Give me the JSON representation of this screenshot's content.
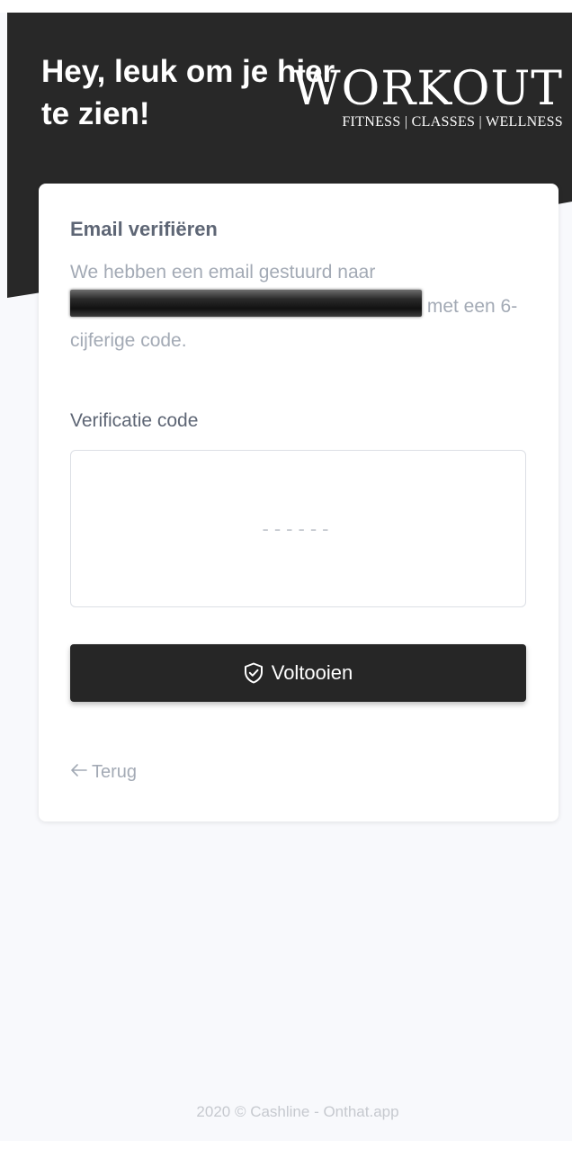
{
  "header": {
    "greeting": "Hey, leuk om je hier te zien!",
    "brand_name": "WORKOUT",
    "brand_tagline": "FITNESS | CLASSES | WELLNESS"
  },
  "verify": {
    "title": "Email verifiëren",
    "description_start": "We hebben een email gestuurd naar",
    "description_end": "met een 6-cijferige code.",
    "code_label": "Verificatie code",
    "code_placeholder": "------",
    "code_value": "",
    "submit_label": "Voltooien",
    "submit_icon": "shield-check-icon",
    "back_label": "Terug",
    "back_icon": "arrow-left-icon"
  },
  "footer": {
    "text": "2020 © Cashline - Onthat.app"
  },
  "colors": {
    "header_bg": "#282828",
    "page_bg": "#f8f9fc",
    "button_bg": "#262626",
    "muted_text": "#a3aab5",
    "title_text": "#5e6675"
  }
}
